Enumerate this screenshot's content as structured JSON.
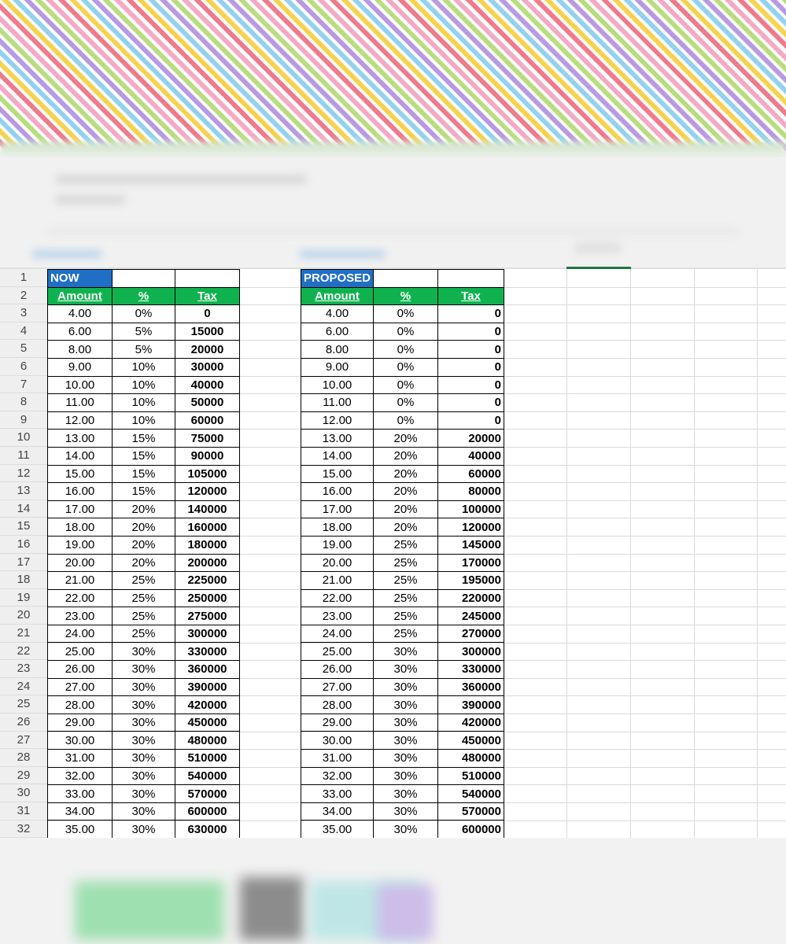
{
  "colors": {
    "now_title_bg": "#1f6fc5",
    "header_bg": "#10b24f",
    "header_text": "#ffffff",
    "border": "#000000",
    "active_column": "#217346"
  },
  "row_numbers": [
    "1",
    "2",
    "3",
    "4",
    "5",
    "6",
    "7",
    "8",
    "9",
    "10",
    "11",
    "12",
    "13",
    "14",
    "15",
    "16",
    "17",
    "18",
    "19",
    "20",
    "21",
    "22",
    "23",
    "24",
    "25",
    "26",
    "27",
    "28",
    "29",
    "30",
    "31",
    "32"
  ],
  "now": {
    "title": "NOW",
    "headers": [
      "Amount",
      "%",
      "Tax"
    ],
    "rows": [
      [
        "4.00",
        "0%",
        "0"
      ],
      [
        "6.00",
        "5%",
        "15000"
      ],
      [
        "8.00",
        "5%",
        "20000"
      ],
      [
        "9.00",
        "10%",
        "30000"
      ],
      [
        "10.00",
        "10%",
        "40000"
      ],
      [
        "11.00",
        "10%",
        "50000"
      ],
      [
        "12.00",
        "10%",
        "60000"
      ],
      [
        "13.00",
        "15%",
        "75000"
      ],
      [
        "14.00",
        "15%",
        "90000"
      ],
      [
        "15.00",
        "15%",
        "105000"
      ],
      [
        "16.00",
        "15%",
        "120000"
      ],
      [
        "17.00",
        "20%",
        "140000"
      ],
      [
        "18.00",
        "20%",
        "160000"
      ],
      [
        "19.00",
        "20%",
        "180000"
      ],
      [
        "20.00",
        "20%",
        "200000"
      ],
      [
        "21.00",
        "25%",
        "225000"
      ],
      [
        "22.00",
        "25%",
        "250000"
      ],
      [
        "23.00",
        "25%",
        "275000"
      ],
      [
        "24.00",
        "25%",
        "300000"
      ],
      [
        "25.00",
        "30%",
        "330000"
      ],
      [
        "26.00",
        "30%",
        "360000"
      ],
      [
        "27.00",
        "30%",
        "390000"
      ],
      [
        "28.00",
        "30%",
        "420000"
      ],
      [
        "29.00",
        "30%",
        "450000"
      ],
      [
        "30.00",
        "30%",
        "480000"
      ],
      [
        "31.00",
        "30%",
        "510000"
      ],
      [
        "32.00",
        "30%",
        "540000"
      ],
      [
        "33.00",
        "30%",
        "570000"
      ],
      [
        "34.00",
        "30%",
        "600000"
      ],
      [
        "35.00",
        "30%",
        "630000"
      ]
    ]
  },
  "proposed": {
    "title": "PROPOSED",
    "headers": [
      "Amount",
      "%",
      "Tax"
    ],
    "rows": [
      [
        "4.00",
        "0%",
        "0"
      ],
      [
        "6.00",
        "0%",
        "0"
      ],
      [
        "8.00",
        "0%",
        "0"
      ],
      [
        "9.00",
        "0%",
        "0"
      ],
      [
        "10.00",
        "0%",
        "0"
      ],
      [
        "11.00",
        "0%",
        "0"
      ],
      [
        "12.00",
        "0%",
        "0"
      ],
      [
        "13.00",
        "20%",
        "20000"
      ],
      [
        "14.00",
        "20%",
        "40000"
      ],
      [
        "15.00",
        "20%",
        "60000"
      ],
      [
        "16.00",
        "20%",
        "80000"
      ],
      [
        "17.00",
        "20%",
        "100000"
      ],
      [
        "18.00",
        "20%",
        "120000"
      ],
      [
        "19.00",
        "25%",
        "145000"
      ],
      [
        "20.00",
        "25%",
        "170000"
      ],
      [
        "21.00",
        "25%",
        "195000"
      ],
      [
        "22.00",
        "25%",
        "220000"
      ],
      [
        "23.00",
        "25%",
        "245000"
      ],
      [
        "24.00",
        "25%",
        "270000"
      ],
      [
        "25.00",
        "30%",
        "300000"
      ],
      [
        "26.00",
        "30%",
        "330000"
      ],
      [
        "27.00",
        "30%",
        "360000"
      ],
      [
        "28.00",
        "30%",
        "390000"
      ],
      [
        "29.00",
        "30%",
        "420000"
      ],
      [
        "30.00",
        "30%",
        "450000"
      ],
      [
        "31.00",
        "30%",
        "480000"
      ],
      [
        "32.00",
        "30%",
        "510000"
      ],
      [
        "33.00",
        "30%",
        "540000"
      ],
      [
        "34.00",
        "30%",
        "570000"
      ],
      [
        "35.00",
        "30%",
        "600000"
      ]
    ]
  }
}
